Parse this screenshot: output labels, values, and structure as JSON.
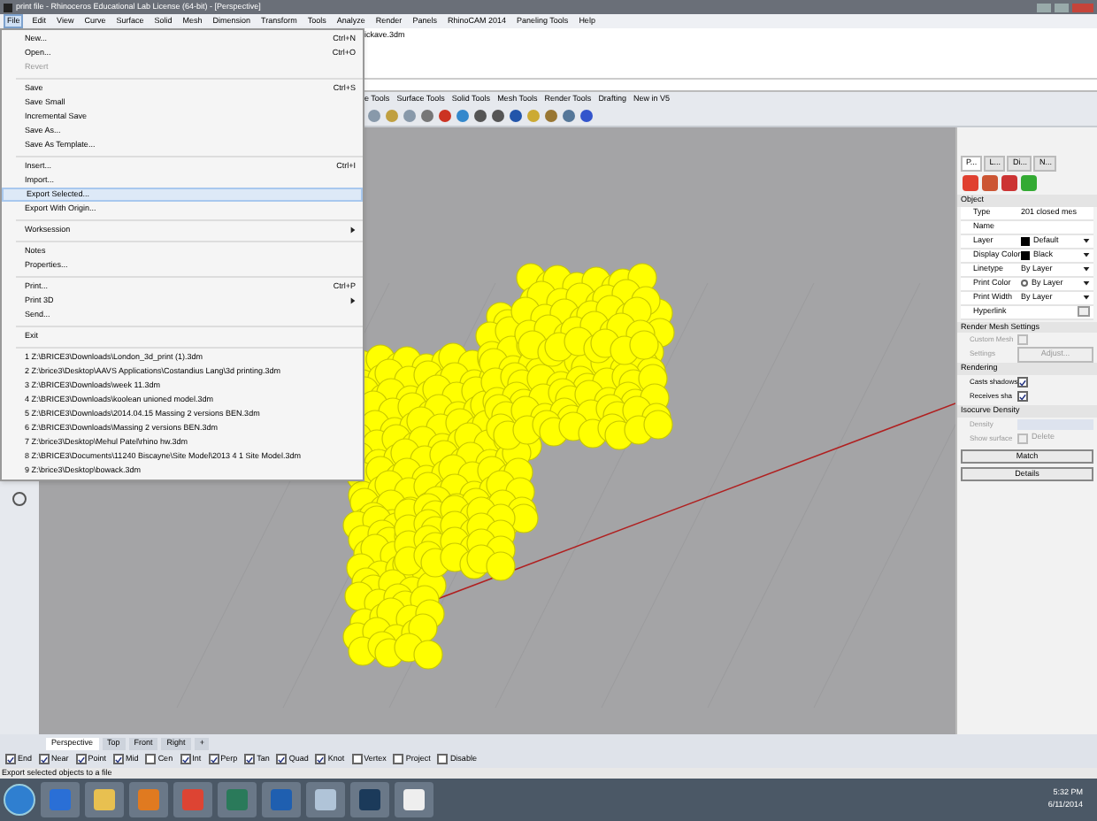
{
  "window": {
    "title": "print file - Rhinoceros Educational Lab License (64-bit) - [Perspective]"
  },
  "menu_bar": [
    {
      "label": "File",
      "selected": true
    },
    {
      "label": "Edit",
      "selected": false
    },
    {
      "label": "View",
      "selected": false
    },
    {
      "label": "Curve",
      "selected": false
    },
    {
      "label": "Surface",
      "selected": false
    },
    {
      "label": "Solid",
      "selected": false
    },
    {
      "label": "Mesh",
      "selected": false
    },
    {
      "label": "Dimension",
      "selected": false
    },
    {
      "label": "Transform",
      "selected": false
    },
    {
      "label": "Tools",
      "selected": false
    },
    {
      "label": "Analyze",
      "selected": false
    },
    {
      "label": "Render",
      "selected": false
    },
    {
      "label": "Panels",
      "selected": false
    },
    {
      "label": "RhinoCAM 2014",
      "selected": false
    },
    {
      "label": "Paneling Tools",
      "selected": false
    },
    {
      "label": "Help",
      "selected": false
    }
  ],
  "command_history": "ickave.3dm",
  "toolbar_tabs": [
    "e Tools",
    "Surface Tools",
    "Solid Tools",
    "Mesh Tools",
    "Render Tools",
    "Drafting",
    "New in V5"
  ],
  "file_menu": [
    {
      "kind": "item",
      "label": "New...",
      "shortcut": "Ctrl+N",
      "disabled": false,
      "selected": false
    },
    {
      "kind": "item",
      "label": "Open...",
      "shortcut": "Ctrl+O",
      "disabled": false,
      "selected": false
    },
    {
      "kind": "item",
      "label": "Revert",
      "disabled": true,
      "selected": false
    },
    {
      "kind": "separator"
    },
    {
      "kind": "item",
      "label": "Save",
      "shortcut": "Ctrl+S",
      "disabled": false,
      "selected": false
    },
    {
      "kind": "item",
      "label": "Save Small",
      "disabled": false,
      "selected": false
    },
    {
      "kind": "item",
      "label": "Incremental Save",
      "disabled": false,
      "selected": false
    },
    {
      "kind": "item",
      "label": "Save As...",
      "disabled": false,
      "selected": false
    },
    {
      "kind": "item",
      "label": "Save As Template...",
      "disabled": false,
      "selected": false
    },
    {
      "kind": "separator"
    },
    {
      "kind": "item",
      "label": "Insert...",
      "shortcut": "Ctrl+I",
      "disabled": false,
      "selected": false
    },
    {
      "kind": "item",
      "label": "Import...",
      "disabled": false,
      "selected": false
    },
    {
      "kind": "item",
      "label": "Export Selected...",
      "disabled": false,
      "selected": true
    },
    {
      "kind": "item",
      "label": "Export With Origin...",
      "disabled": false,
      "selected": false
    },
    {
      "kind": "separator"
    },
    {
      "kind": "submenu",
      "label": "Worksession",
      "disabled": false,
      "selected": false
    },
    {
      "kind": "separator"
    },
    {
      "kind": "item",
      "label": "Notes",
      "disabled": false,
      "selected": false
    },
    {
      "kind": "item",
      "label": "Properties...",
      "disabled": false,
      "selected": false
    },
    {
      "kind": "separator"
    },
    {
      "kind": "item",
      "label": "Print...",
      "shortcut": "Ctrl+P",
      "disabled": false,
      "selected": false
    },
    {
      "kind": "submenu",
      "label": "Print 3D",
      "disabled": false,
      "selected": false
    },
    {
      "kind": "item",
      "label": "Send...",
      "disabled": false,
      "selected": false
    },
    {
      "kind": "separator"
    },
    {
      "kind": "item",
      "label": "Exit",
      "disabled": false,
      "selected": false
    },
    {
      "kind": "separator"
    },
    {
      "kind": "item",
      "label": "1 Z:\\BRICE3\\Downloads\\London_3d_print (1).3dm",
      "disabled": false,
      "selected": false
    },
    {
      "kind": "item",
      "label": "2 Z:\\brice3\\Desktop\\AAVS Applications\\Costandius Lang\\3d printing.3dm",
      "disabled": false,
      "selected": false
    },
    {
      "kind": "item",
      "label": "3 Z:\\BRICE3\\Downloads\\week 11.3dm",
      "disabled": false,
      "selected": false
    },
    {
      "kind": "item",
      "label": "4 Z:\\BRICE3\\Downloads\\koolean unioned model.3dm",
      "disabled": false,
      "selected": false
    },
    {
      "kind": "item",
      "label": "5 Z:\\BRICE3\\Downloads\\2014.04.15 Massing 2 versions BEN.3dm",
      "disabled": false,
      "selected": false
    },
    {
      "kind": "item",
      "label": "6 Z:\\BRICE3\\Downloads\\Massing 2 versions BEN.3dm",
      "disabled": false,
      "selected": false
    },
    {
      "kind": "item",
      "label": "7 Z:\\brice3\\Desktop\\Mehul Patel\\rhino hw.3dm",
      "disabled": false,
      "selected": false
    },
    {
      "kind": "item",
      "label": "8 Z:\\BRICE3\\Documents\\11240 Biscayne\\Site Model\\2013 4 1 Site Model.3dm",
      "disabled": false,
      "selected": false
    },
    {
      "kind": "item",
      "label": "9 Z:\\brice3\\Desktop\\bowack.3dm",
      "disabled": false,
      "selected": false
    }
  ],
  "panel": {
    "tabs": [
      {
        "label": "P...",
        "selected": true
      },
      {
        "label": "L...",
        "selected": false
      },
      {
        "label": "Di...",
        "selected": false
      },
      {
        "label": "N...",
        "selected": false
      }
    ],
    "object_heading": "Object",
    "properties": [
      {
        "kind": "text",
        "label": "Type",
        "value": "201 closed mes"
      },
      {
        "kind": "text",
        "label": "Name"
      },
      {
        "kind": "swatch",
        "label": "Layer",
        "value": "Default",
        "color": "#000000"
      },
      {
        "kind": "swatch",
        "label": "Display Color",
        "value": "Black",
        "color": "#000000"
      },
      {
        "kind": "dropdown",
        "label": "Linetype",
        "value": "By Layer"
      },
      {
        "kind": "radio",
        "label": "Print Color",
        "value": "By Layer"
      },
      {
        "kind": "dropdown",
        "label": "Print Width",
        "value": "By Layer"
      },
      {
        "kind": "button",
        "label": "Hyperlink"
      }
    ],
    "sections": [
      {
        "heading": "Render Mesh Settings",
        "rows": [
          {
            "kind": "checkbox",
            "label": "Custom Mesh",
            "checked": false,
            "disabled": true
          },
          {
            "kind": "button",
            "label": "Settings",
            "value": "Adjust...",
            "disabled": true
          }
        ]
      },
      {
        "heading": "Rendering",
        "rows": [
          {
            "kind": "checkbox",
            "label": "Casts shadows",
            "checked": true,
            "disabled": false
          },
          {
            "kind": "checkbox",
            "label": "Receives sha",
            "checked": true,
            "disabled": false
          }
        ]
      },
      {
        "heading": "Isocurve Density",
        "rows": [
          {
            "kind": "field",
            "label": "Density",
            "disabled": true
          },
          {
            "kind": "checkbox",
            "label": "Show surface",
            "value": "Delete",
            "checked": false,
            "disabled": true
          }
        ]
      }
    ],
    "buttons": [
      "Match",
      "Details"
    ]
  },
  "viewport_tabs": [
    {
      "label": "Perspective",
      "selected": true
    },
    {
      "label": "Top",
      "selected": false
    },
    {
      "label": "Front",
      "selected": false
    },
    {
      "label": "Right",
      "selected": false
    },
    {
      "label": "+",
      "selected": false
    }
  ],
  "osnaps": [
    {
      "label": "End",
      "checked": true
    },
    {
      "label": "Near",
      "checked": true
    },
    {
      "label": "Point",
      "checked": true
    },
    {
      "label": "Mid",
      "checked": true
    },
    {
      "label": "Cen",
      "checked": false
    },
    {
      "label": "Int",
      "checked": true
    },
    {
      "label": "Perp",
      "checked": true
    },
    {
      "label": "Tan",
      "checked": true
    },
    {
      "label": "Quad",
      "checked": true
    },
    {
      "label": "Knot",
      "checked": true
    },
    {
      "label": "Vertex",
      "checked": false
    },
    {
      "label": "Project",
      "checked": false
    },
    {
      "label": "Disable",
      "checked": false
    }
  ],
  "status_bar": "Export selected objects to a file",
  "clock": {
    "time": "5:32 PM",
    "date": "6/11/2014"
  }
}
